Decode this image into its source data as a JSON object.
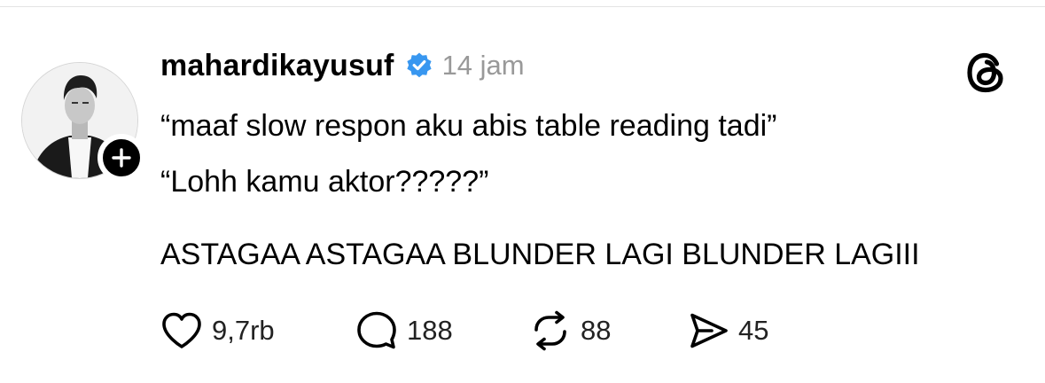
{
  "post": {
    "username": "mahardikayusuf",
    "timestamp": "14 jam",
    "lines": [
      "“maaf slow respon aku abis table reading tadi”",
      "“Lohh kamu aktor?????”",
      "ASTAGAA ASTAGAA BLUNDER LAGI BLUNDER LAGIII"
    ],
    "stats": {
      "likes": "9,7rb",
      "replies": "188",
      "reposts": "88",
      "shares": "45"
    }
  },
  "icons": {
    "avatar": "profile-photo",
    "follow": "plus-icon",
    "verified": "verified-badge-icon",
    "brand": "threads-logo-icon",
    "like": "heart-icon",
    "reply": "speech-bubble-icon",
    "repost": "repost-icon",
    "share": "send-icon"
  },
  "colors": {
    "verified": "#3897f0",
    "muted": "#999999",
    "text": "#000000"
  }
}
